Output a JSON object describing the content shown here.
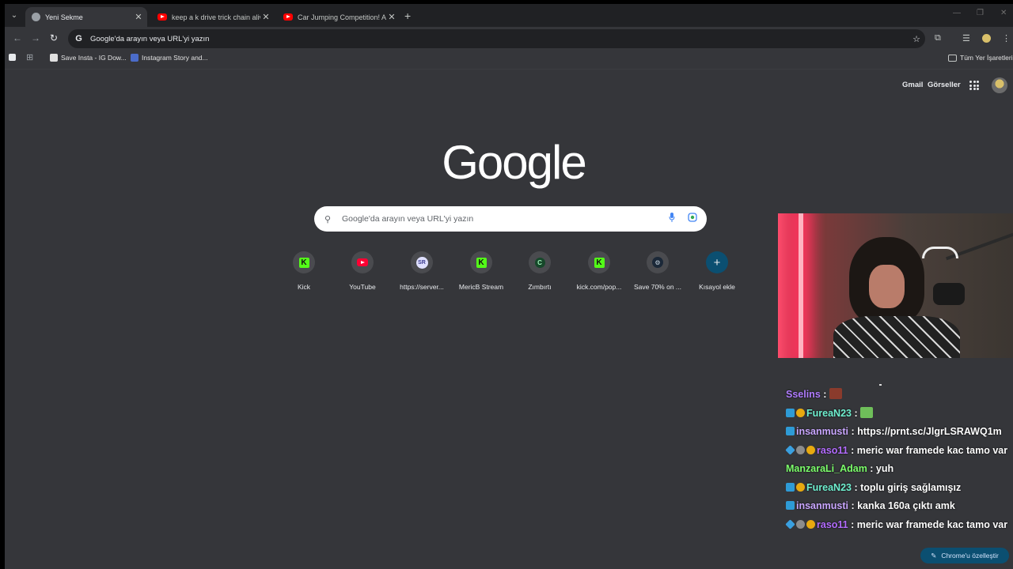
{
  "browser": {
    "tabs": [
      {
        "title": "Yeni Sekme",
        "active": true
      },
      {
        "title": "keep a k drive trick chain alive",
        "active": false
      },
      {
        "title": "Car Jumping Competition! Ang",
        "active": false
      }
    ],
    "new_tab_symbol": "+",
    "close_symbol": "✕",
    "omnibox_text": "Google'da arayın veya URL'yi yazın",
    "omnibox_g": "G"
  },
  "bookmarks": {
    "items": [
      {
        "label": "Save Insta - IG Dow..."
      },
      {
        "label": "Instagram Story and..."
      }
    ],
    "all_bookmarks": "Tüm Yer İşaretleri"
  },
  "ntp": {
    "gmail": "Gmail",
    "images": "Görseller",
    "logo": "Google",
    "search_placeholder": "Google'da arayın veya URL'yi yazın",
    "shortcuts": [
      {
        "label": "Kick",
        "icon": "kick-icon",
        "glyph": "K"
      },
      {
        "label": "YouTube",
        "icon": "youtube-icon",
        "glyph": ""
      },
      {
        "label": "https://server...",
        "icon": "server-icon",
        "glyph": "SR"
      },
      {
        "label": "MericB Stream",
        "icon": "kick-icon",
        "glyph": "K"
      },
      {
        "label": "Zımbırtı",
        "icon": "c-icon",
        "glyph": "C"
      },
      {
        "label": "kick.com/pop...",
        "icon": "kick-icon",
        "glyph": "K"
      },
      {
        "label": "Save 70% on ...",
        "icon": "steam-icon",
        "glyph": "⚙"
      },
      {
        "label": "Kısayol ekle",
        "icon": "plus-icon",
        "glyph": "+"
      }
    ],
    "customize_label": "Chrome'u özelleştir"
  },
  "chat": {
    "messages": [
      {
        "user": "Sselins",
        "color": "#b07cff",
        "badges": [],
        "text": "",
        "emote": "#8a3b2c"
      },
      {
        "user": "FureaN23",
        "color": "#6ff0d0",
        "badges": [
          "blue",
          "gold"
        ],
        "text": "",
        "emote": "#6fbf5a"
      },
      {
        "user": "insanmusti",
        "color": "#c9a6ff",
        "badges": [
          "blue"
        ],
        "text": "https://prnt.sc/JlgrLSRAWQ1m",
        "emote": ""
      },
      {
        "user": "raso11",
        "color": "#b36cff",
        "badges": [
          "cube",
          "gear",
          "gold"
        ],
        "text": "meric war framede kac tamo var",
        "emote": ""
      },
      {
        "user": "ManzaraLi_Adam",
        "color": "#7cff6b",
        "badges": [],
        "text": "yuh",
        "emote": ""
      },
      {
        "user": "FureaN23",
        "color": "#6ff0d0",
        "badges": [
          "blue",
          "gold"
        ],
        "text": "toplu giriş sağlamışız",
        "emote": ""
      },
      {
        "user": "insanmusti",
        "color": "#c9a6ff",
        "badges": [
          "blue"
        ],
        "text": "kanka 160a çıktı amk",
        "emote": ""
      },
      {
        "user": "raso11",
        "color": "#b36cff",
        "badges": [
          "cube",
          "gear",
          "gold"
        ],
        "text": "meric war framede kac tamo var",
        "emote": ""
      }
    ],
    "separator": " : "
  }
}
